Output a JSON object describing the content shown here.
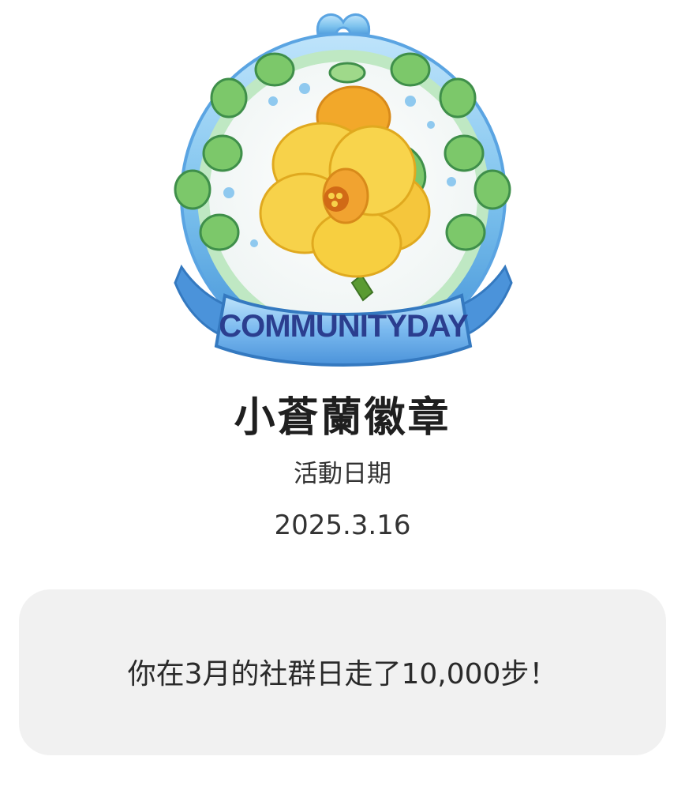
{
  "badge": {
    "ribbon_text": "COMMUNITYDAY",
    "colors": {
      "frame": "#7ec3ee",
      "frame_dark": "#3f8fd6",
      "ribbon": "#62b2ee",
      "ribbon_text": "#2b3e8f",
      "leaf": "#7cc86a",
      "flower": "#f7cc3a",
      "flower_center": "#e07a20"
    },
    "icon": "yellow-flower-badge-icon"
  },
  "title": "小蒼蘭徽章",
  "date_label": "活動日期",
  "date_value": "2025.3.16",
  "message": "你在3月的社群日走了10,000步！"
}
